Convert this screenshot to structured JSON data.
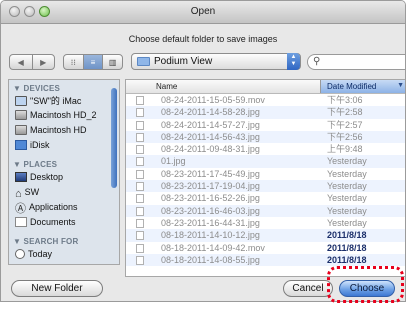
{
  "window": {
    "title": "Open"
  },
  "prompt": "Choose default folder to save images",
  "toolbar": {
    "back_icon": "◀",
    "forward_icon": "▶",
    "view_icons": [
      "⁝⁝",
      "≡",
      "▥"
    ],
    "location": "Podium View",
    "search_placeholder": ""
  },
  "sidebar": {
    "devices_header": "DEVICES",
    "devices": [
      "\"SW\"的 iMac",
      "Macintosh HD_2",
      "Macintosh HD",
      "iDisk"
    ],
    "places_header": "PLACES",
    "places": [
      "Desktop",
      "SW",
      "Applications",
      "Documents"
    ],
    "search_header": "SEARCH FOR",
    "search": [
      "Today"
    ]
  },
  "filelist": {
    "columns": {
      "name": "Name",
      "date": "Date Modified"
    },
    "rows": [
      {
        "name": "08-24-2011-15-05-59.mov",
        "date": "下午3:06"
      },
      {
        "name": "08-24-2011-14-58-28.jpg",
        "date": "下午2:58"
      },
      {
        "name": "08-24-2011-14-57-27.jpg",
        "date": "下午2:57"
      },
      {
        "name": "08-24-2011-14-56-43.jpg",
        "date": "下午2:56"
      },
      {
        "name": "08-24-2011-09-48-31.jpg",
        "date": "上午9:48"
      },
      {
        "name": "01.jpg",
        "date": "Yesterday"
      },
      {
        "name": "08-23-2011-17-45-49.jpg",
        "date": "Yesterday"
      },
      {
        "name": "08-23-2011-17-19-04.jpg",
        "date": "Yesterday"
      },
      {
        "name": "08-23-2011-16-52-26.jpg",
        "date": "Yesterday"
      },
      {
        "name": "08-23-2011-16-46-03.jpg",
        "date": "Yesterday"
      },
      {
        "name": "08-23-2011-16-44-31.jpg",
        "date": "Yesterday"
      },
      {
        "name": "08-18-2011-14-10-12.jpg",
        "date": "2011/8/18"
      },
      {
        "name": "08-18-2011-14-09-42.mov",
        "date": "2011/8/18"
      },
      {
        "name": "08-18-2011-14-08-55.jpg",
        "date": "2011/8/18"
      }
    ]
  },
  "buttons": {
    "new_folder": "New Folder",
    "cancel": "Cancel",
    "choose": "Choose"
  },
  "colors": {
    "highlight": "#e8001c",
    "selection": "#3d78d2"
  }
}
